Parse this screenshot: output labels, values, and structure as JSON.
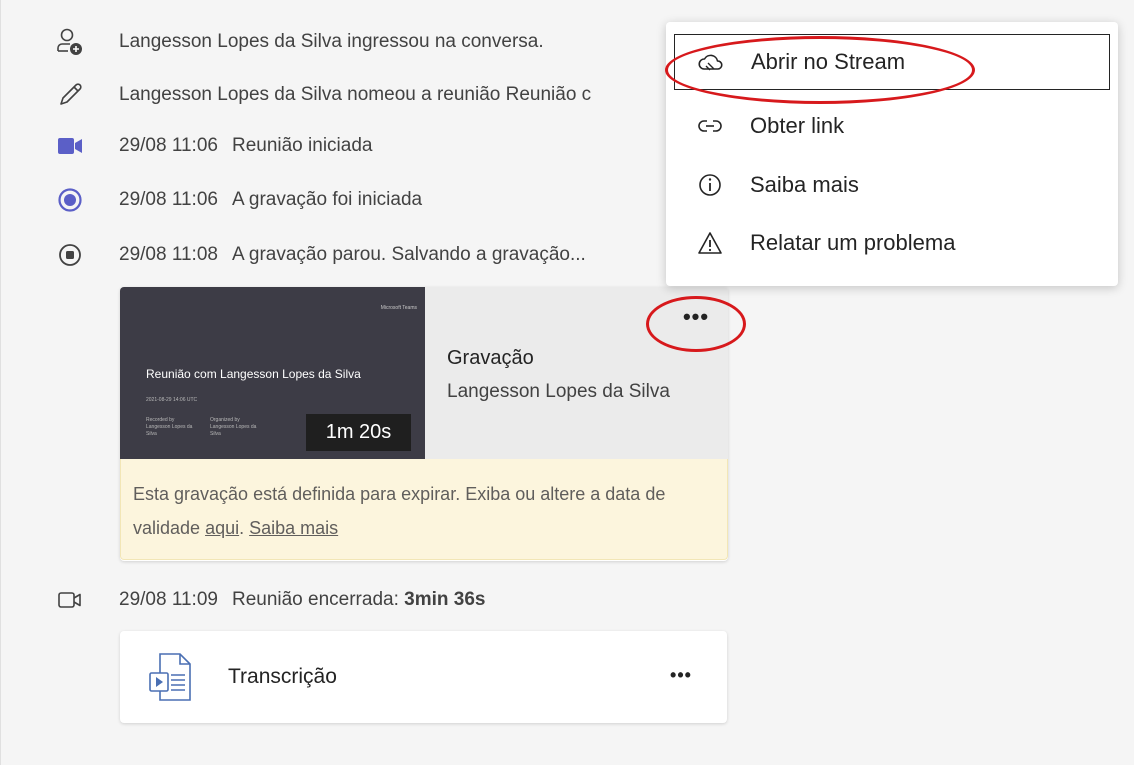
{
  "events": [
    {
      "icon": "person-add-icon",
      "time": "",
      "text": "Langesson Lopes da Silva ingressou na conversa."
    },
    {
      "icon": "pencil-icon",
      "time": "",
      "text": "Langesson Lopes da Silva nomeou a reunião Reunião c"
    },
    {
      "icon": "video-camera-icon",
      "time": "29/08 11:06",
      "text": "Reunião iniciada"
    },
    {
      "icon": "record-icon",
      "time": "29/08 11:06",
      "text": "A gravação foi iniciada"
    },
    {
      "icon": "stop-icon",
      "time": "29/08 11:08",
      "text": "A gravação parou. Salvando a gravação..."
    }
  ],
  "recording": {
    "thumbnail": {
      "brand": "Microsoft Teams",
      "title": "Reunião com Langesson Lopes da Silva",
      "date": "2021-08-29 14:06 UTC",
      "meta1": "Recorded by Langesson Lopes da Silva",
      "meta2": "Organized by Langesson Lopes da Silva"
    },
    "duration": "1m 20s",
    "title": "Gravação",
    "author": "Langesson Lopes da Silva",
    "more_label": "•••",
    "notice_prefix": "Esta gravação está definida para expirar. Exiba ou altere a data de validade ",
    "notice_link1": "aqui",
    "notice_sep": ". ",
    "notice_link2": "Saiba mais"
  },
  "meeting_end": {
    "time": "29/08 11:09",
    "text": "Reunião encerrada: ",
    "duration": "3min 36s"
  },
  "transcript": {
    "title": "Transcrição",
    "more_label": "•••"
  },
  "menu": {
    "items": [
      {
        "icon": "stream-icon",
        "label": "Abrir no Stream"
      },
      {
        "icon": "link-icon",
        "label": "Obter link"
      },
      {
        "icon": "info-icon",
        "label": "Saiba mais"
      },
      {
        "icon": "warning-icon",
        "label": "Relatar um problema"
      }
    ]
  },
  "colors": {
    "accent": "#5b5fc7",
    "annotation": "#d7191c",
    "notice_bg": "#fcf5dd"
  }
}
